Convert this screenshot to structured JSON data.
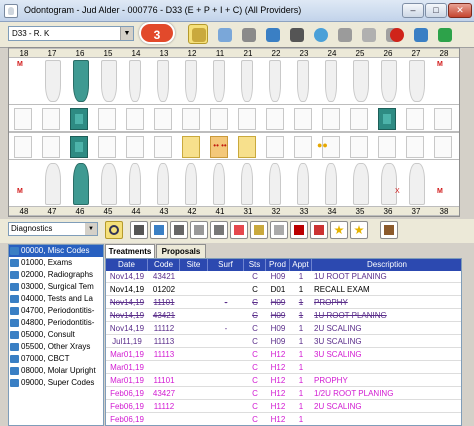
{
  "window": {
    "title": "Odontogram - Jud Alder - 000776 - D33  (E + P + I + C)  (All Providers)",
    "min_label": "–",
    "max_label": "□",
    "close_label": "✕"
  },
  "toolbar": {
    "tooth_select": "D33 - R. K",
    "callout": "3",
    "buttons": [
      "tooth-select-tool",
      "hygiene-tool",
      "print",
      "perio-chart",
      "x-ray",
      "refresh",
      "open-folder",
      "notes",
      "lab",
      "save",
      "cancel",
      "forward",
      "green-recycle"
    ]
  },
  "chart": {
    "upper_numbers": [
      "18",
      "17",
      "16",
      "15",
      "14",
      "13",
      "12",
      "11",
      "21",
      "22",
      "23",
      "24",
      "25",
      "26",
      "27",
      "28"
    ],
    "lower_numbers": [
      "48",
      "47",
      "46",
      "45",
      "44",
      "43",
      "42",
      "41",
      "31",
      "32",
      "33",
      "34",
      "35",
      "36",
      "37",
      "38"
    ],
    "missing_mark": "M",
    "x_mark": "X",
    "colors": {
      "teal": "#2e8b83",
      "yellow": "#f7e08c",
      "orange": "#f4c87a"
    }
  },
  "diagnosis_select": "Diagnostics",
  "code_categories": [
    "00000, Misc Codes",
    "01000, Exams",
    "02000, Radiographs",
    "03000, Surgical Tem",
    "04000, Tests and La",
    "04700, Periodontitis-",
    "04800, Periodontitis-",
    "05000, Consult",
    "05500, Other Xrays",
    "07000, CBCT",
    "08000, Molar Upright",
    "09000, Super Codes"
  ],
  "tabs": {
    "treatments": "Treatments",
    "proposals": "Proposals"
  },
  "table": {
    "headers": [
      "Date",
      "Code",
      "Site",
      "Surf",
      "Sts",
      "Prod",
      "Appt",
      "Description"
    ],
    "rows": [
      {
        "date": "Nov14,19",
        "code": "43421",
        "site": "",
        "surf": "",
        "sts": "C",
        "prod": "H09",
        "appt": "1",
        "desc": "1U ROOT PLANING",
        "color": "purple",
        "strike": false
      },
      {
        "date": "Nov14,19",
        "code": "01202",
        "site": "",
        "surf": "",
        "sts": "C",
        "prod": "D01",
        "appt": "1",
        "desc": "RECALL EXAM",
        "color": "black",
        "strike": false
      },
      {
        "date": "Nov14,19",
        "code": "11101",
        "site": "",
        "surf": "-",
        "sts": "C",
        "prod": "H09",
        "appt": "1",
        "desc": "PROPHY",
        "color": "purple",
        "strike": true
      },
      {
        "date": "Nov14,19",
        "code": "43421",
        "site": "",
        "surf": "",
        "sts": "C",
        "prod": "H09",
        "appt": "1",
        "desc": "1U ROOT PLANING",
        "color": "purple",
        "strike": true
      },
      {
        "date": "Nov14,19",
        "code": "11112",
        "site": "",
        "surf": "-",
        "sts": "C",
        "prod": "H09",
        "appt": "1",
        "desc": "2U SCALING",
        "color": "purple",
        "strike": false
      },
      {
        "date": "Jul11,19",
        "code": "11113",
        "site": "",
        "surf": "",
        "sts": "C",
        "prod": "H09",
        "appt": "1",
        "desc": "3U SCALING",
        "color": "purple",
        "strike": false
      },
      {
        "date": "Mar01,19",
        "code": "11113",
        "site": "",
        "surf": "",
        "sts": "C",
        "prod": "H12",
        "appt": "1",
        "desc": "3U SCALING",
        "color": "magenta",
        "strike": false
      },
      {
        "date": "Mar01,19",
        "code": "",
        "site": "",
        "surf": "",
        "sts": "C",
        "prod": "H12",
        "appt": "1",
        "desc": "",
        "color": "magenta",
        "strike": false
      },
      {
        "date": "Mar01,19",
        "code": "11101",
        "site": "",
        "surf": "",
        "sts": "C",
        "prod": "H12",
        "appt": "1",
        "desc": "PROPHY",
        "color": "magenta",
        "strike": false
      },
      {
        "date": "Feb06,19",
        "code": "43427",
        "site": "",
        "surf": "",
        "sts": "C",
        "prod": "H12",
        "appt": "1",
        "desc": "1/2U ROOT PLANING",
        "color": "magenta",
        "strike": false
      },
      {
        "date": "Feb06,19",
        "code": "11112",
        "site": "",
        "surf": "",
        "sts": "C",
        "prod": "H12",
        "appt": "1",
        "desc": "2U SCALING",
        "color": "magenta",
        "strike": false
      },
      {
        "date": "Feb06,19",
        "code": "",
        "site": "",
        "surf": "",
        "sts": "C",
        "prod": "H12",
        "appt": "1",
        "desc": "",
        "color": "magenta",
        "strike": false
      }
    ]
  }
}
